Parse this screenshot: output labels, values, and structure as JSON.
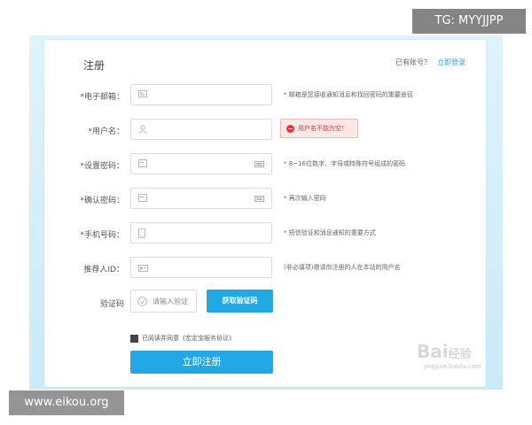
{
  "form": {
    "title": "注册",
    "has_account_text": "已有账号？",
    "login_link": "立即登录",
    "fields": [
      {
        "label": "*电子邮箱：",
        "placeholder": "",
        "icon": "mail-icon",
        "hint": "* 邮箱是您接收通知消息和找回密码的重要途径"
      },
      {
        "label": "*用户名：",
        "placeholder": "",
        "icon": "user-icon",
        "hint": ""
      },
      {
        "label": "*设置密码：",
        "placeholder": "",
        "icon": "lock-icon",
        "hint": "* 8~16位数字、字母或特殊符号组成的密码"
      },
      {
        "label": "*确认密码：",
        "placeholder": "",
        "icon": "lock-icon",
        "hint": "* 再次输入密码"
      },
      {
        "label": "*手机号码：",
        "placeholder": "",
        "icon": "phone-icon",
        "hint": "* 短信验证和消息通知的重要方式"
      },
      {
        "label": "推荐人ID：",
        "placeholder": "",
        "icon": "id-card-icon",
        "hint": "(非必填项)邀请你注册的人在本站的用户名"
      }
    ],
    "username_error": "用户名不能为空！",
    "captcha": {
      "label": "验证码",
      "placeholder": "请输入验证",
      "button": "获取验证码"
    },
    "agreement": {
      "prefix": "已阅读并同意",
      "protocol": "《宏定宝服务协议》",
      "checked": true
    },
    "submit": "立即注册"
  },
  "watermarks": {
    "tg": "TG: MYYJJPP",
    "site": "www.eikou.org",
    "baidu": "Bai",
    "baidu_cn": "经验",
    "baidu_sub": "jingyan.baidu.com"
  },
  "colors": {
    "accent": "#22a8e4",
    "error": "#e33333",
    "backdrop": "#d4eef9"
  }
}
